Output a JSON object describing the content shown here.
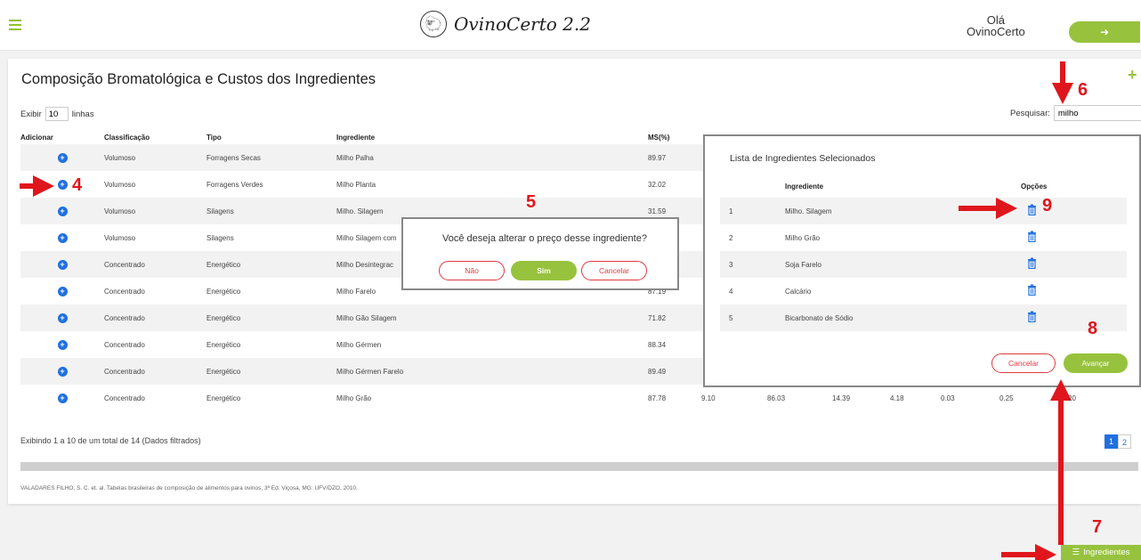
{
  "header": {
    "app_title": "OvinoCerto 2.2",
    "greeting_line1": "Olá",
    "greeting_line2": "OvinoCerto"
  },
  "page": {
    "title": "Composição Bromatológica e Custos dos Ingredientes",
    "show_label_pre": "Exibir",
    "show_value": "10",
    "show_label_post": "linhas",
    "search_label": "Pesquisar:",
    "search_value": "milho"
  },
  "table": {
    "headers": [
      "Adicionar",
      "Classificação",
      "Tipo",
      "Ingrediente",
      "MS(%)"
    ],
    "rows": [
      {
        "cls": "Volumoso",
        "tipo": "Forragens Secas",
        "ing": "Milho Palha",
        "ms": "89.97"
      },
      {
        "cls": "Volumoso",
        "tipo": "Forragens Verdes",
        "ing": "Milho Planta",
        "ms": "32.02"
      },
      {
        "cls": "Volumoso",
        "tipo": "Silagens",
        "ing": "Milho. Silagem",
        "ms": "31.59"
      },
      {
        "cls": "Volumoso",
        "tipo": "Silagens",
        "ing": "Milho Silagem com",
        "ms": ""
      },
      {
        "cls": "Concentrado",
        "tipo": "Energético",
        "ing": "Milho Desintegrac",
        "ms": ""
      },
      {
        "cls": "Concentrado",
        "tipo": "Energético",
        "ing": "Milho Farelo",
        "ms": "87.19"
      },
      {
        "cls": "Concentrado",
        "tipo": "Energético",
        "ing": "Milho Gão Silagem",
        "ms": "71.82"
      },
      {
        "cls": "Concentrado",
        "tipo": "Energético",
        "ing": "Milho Gérmen",
        "ms": "88.34"
      },
      {
        "cls": "Concentrado",
        "tipo": "Energético",
        "ing": "Milho Gérmen Farelo",
        "ms": "89.49"
      },
      {
        "cls": "Concentrado",
        "tipo": "Energético",
        "ing": "Milho Grão",
        "ms": "87.78"
      }
    ],
    "last_row_extra": [
      "9.10",
      "86.03",
      "14.39",
      "4.18",
      "0.03",
      "0.25",
      "20"
    ]
  },
  "footer": {
    "showing": "Exibindo 1 a 10 de um total de 14 (Dados filtrados)",
    "pages": [
      "1",
      "2"
    ],
    "citation": "VALADARES FILHO, S. C. et. al. Tabelas brasileiras de composição de alimentos para ovinos, 3ª Ed. Viçosa, MG: UFV/DZO, 2010."
  },
  "confirm_dialog": {
    "question": "Você deseja alterar o preço desse ingrediente?",
    "no_label": "Não",
    "yes_label": "Sim",
    "cancel_label": "Cancelar"
  },
  "selected_panel": {
    "title": "Lista de Ingredientes Selecionados",
    "col_ingrediente": "Ingrediente",
    "col_opcoes": "Opções",
    "items": [
      {
        "n": "1",
        "name": "Milho. Silagem"
      },
      {
        "n": "2",
        "name": "Milho Grão"
      },
      {
        "n": "3",
        "name": "Soja Farelo"
      },
      {
        "n": "4",
        "name": "Calcário"
      },
      {
        "n": "5",
        "name": "Bicarbonato de Sódio"
      }
    ],
    "cancel_label": "Cancelar",
    "advance_label": "Avançar"
  },
  "ingredients_button_label": "Ingredientes",
  "annotations": [
    "4",
    "5",
    "6",
    "7",
    "8",
    "9"
  ],
  "colors": {
    "accent_green": "#97c23d",
    "link_blue": "#1f70e0",
    "danger_red": "#e0393e",
    "annotation_red": "#e0161d"
  }
}
